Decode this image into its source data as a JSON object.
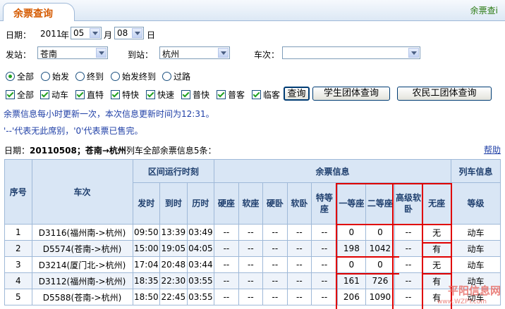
{
  "tab_title": "余票查询",
  "top_link": "余票查i",
  "date": {
    "label": "日期：",
    "year": "2011",
    "year_unit": "年",
    "month": "05",
    "month_unit": "月",
    "day": "08",
    "day_unit": "日"
  },
  "stations": {
    "from_label": "发站：",
    "from": "苍南",
    "to_label": "到站：",
    "to": "杭州",
    "train_label": "车次：",
    "train": ""
  },
  "radios": [
    {
      "label": "全部",
      "checked": true
    },
    {
      "label": "始发",
      "checked": false
    },
    {
      "label": "终到",
      "checked": false
    },
    {
      "label": "始发终到",
      "checked": false
    },
    {
      "label": "过路",
      "checked": false
    }
  ],
  "checkboxes": [
    "全部",
    "动车",
    "直特",
    "特快",
    "快速",
    "普快",
    "普客",
    "临客"
  ],
  "buttons": {
    "query": "查询",
    "student": "学生团体查询",
    "migrant": "农民工团体查询"
  },
  "info": {
    "update_text": "余票信息每小时更新一次，本次信息更新时间为",
    "update_time": "12:31",
    "update_end": "。",
    "legend": "'--'代表无此席别，'0'代表票已售完。"
  },
  "summary": {
    "prefix": "日期：",
    "date": "20110508；",
    "route": "苍南→杭州",
    "suffix": "列车全部余票信息5条："
  },
  "help": "帮助",
  "table": {
    "h_seq": "序号",
    "h_train": "车次",
    "h_time_group": "区间运行时刻",
    "h_ticket_group": "余票信息",
    "h_train_info": "列车信息",
    "h_depart": "发时",
    "h_arrive": "到时",
    "h_duration": "历时",
    "h_seats": [
      "硬座",
      "软座",
      "硬卧",
      "软卧",
      "特等座",
      "一等座",
      "二等座",
      "高级软卧",
      "无座"
    ],
    "h_grade": "等级",
    "rows": [
      {
        "seq": "1",
        "train": "D3116(福州南->杭州)",
        "depart": "09:50",
        "arrive": "13:39",
        "duration": "03:49",
        "seats": [
          "--",
          "--",
          "--",
          "--",
          "--",
          "0",
          "0",
          "--",
          "无"
        ],
        "grade": "动车"
      },
      {
        "seq": "2",
        "train": "D5574(苍南->杭州)",
        "depart": "15:00",
        "arrive": "19:05",
        "duration": "04:05",
        "seats": [
          "--",
          "--",
          "--",
          "--",
          "--",
          "198",
          "1042",
          "--",
          "有"
        ],
        "grade": "动车"
      },
      {
        "seq": "3",
        "train": "D3214(厦门北->杭州)",
        "depart": "17:04",
        "arrive": "20:48",
        "duration": "03:44",
        "seats": [
          "--",
          "--",
          "--",
          "--",
          "--",
          "0",
          "0",
          "--",
          "无"
        ],
        "grade": "动车"
      },
      {
        "seq": "4",
        "train": "D3112(福州南->杭州)",
        "depart": "18:35",
        "arrive": "22:30",
        "duration": "03:55",
        "seats": [
          "--",
          "--",
          "--",
          "--",
          "--",
          "161",
          "726",
          "--",
          "有"
        ],
        "grade": "动车"
      },
      {
        "seq": "5",
        "train": "D5588(苍南->杭州)",
        "depart": "18:50",
        "arrive": "22:45",
        "duration": "03:55",
        "seats": [
          "--",
          "--",
          "--",
          "--",
          "--",
          "206",
          "1090",
          "--",
          "有"
        ],
        "grade": "动车"
      }
    ]
  },
  "watermark": {
    "main": "平阳信息网",
    "url": "www.WZPY.com"
  },
  "colors": {
    "tab_text": "#d55a00",
    "header_bg": "#d9e6f5",
    "highlight": "#e00000",
    "info_text": "#1f3fa6"
  }
}
